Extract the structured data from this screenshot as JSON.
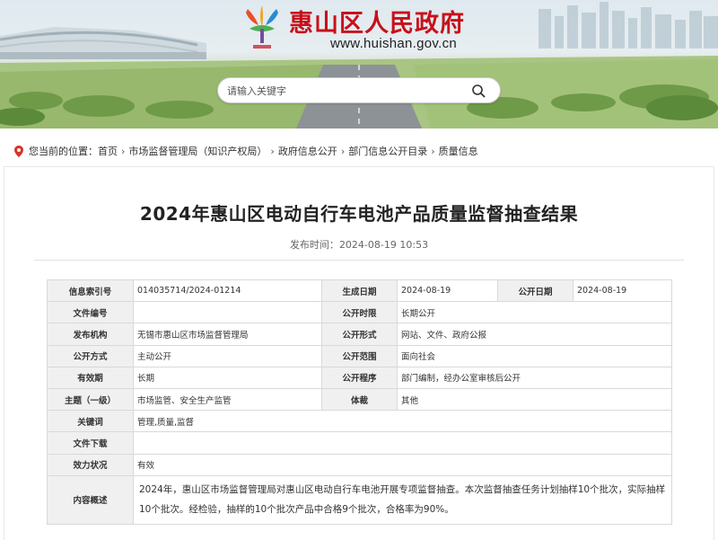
{
  "site": {
    "title": "惠山区人民政府",
    "url": "www.huishan.gov.cn"
  },
  "search": {
    "placeholder": "请输入关键字"
  },
  "breadcrumb": {
    "prefix": "您当前的位置：",
    "items": [
      "首页",
      "市场监督管理局（知识产权局）",
      "政府信息公开",
      "部门信息公开目录",
      "质量信息"
    ],
    "separator": "›"
  },
  "article": {
    "title": "2024年惠山区电动自行车电池产品质量监督抽查结果",
    "publish_label": "发布时间：",
    "publish_time": "2024-08-19 10:53"
  },
  "info_table": {
    "index_label": "信息索引号",
    "index_value": "014035714/2024-01214",
    "created_label": "生成日期",
    "created_value": "2024-08-19",
    "public_date_label": "公开日期",
    "public_date_value": "2024-08-19",
    "doc_no_label": "文件编号",
    "doc_no_value": "",
    "public_period_label": "公开时限",
    "public_period_value": "长期公开",
    "issuer_label": "发布机构",
    "issuer_value": "无锡市惠山区市场监督管理局",
    "public_form_label": "公开形式",
    "public_form_value": "网站、文件、政府公报",
    "public_method_label": "公开方式",
    "public_method_value": "主动公开",
    "public_scope_label": "公开范围",
    "public_scope_value": "面向社会",
    "validity_label": "有效期",
    "validity_value": "长期",
    "procedure_label": "公开程序",
    "procedure_value": "部门编制，经办公室审核后公开",
    "topic_label": "主题（一级）",
    "topic_value": "市场监管、安全生产监管",
    "genre_label": "体裁",
    "genre_value": "其他",
    "keywords_label": "关键词",
    "keywords_value": "管理,质量,监督",
    "download_label": "文件下载",
    "download_value": "",
    "status_label": "效力状况",
    "status_value": "有效",
    "summary_label": "内容概述",
    "summary_value": "2024年，惠山区市场监督管理局对惠山区电动自行车电池开展专项监督抽查。本次监督抽查任务计划抽样10个批次，实际抽样10个批次。经检验，抽样的10个批次产品中合格9个批次，合格率为90%。"
  },
  "colors": {
    "title_red": "#c8101a",
    "label_bg": "#f0f0f0",
    "border": "#d9d9d9"
  },
  "icons": {
    "logo": "huishan-logo-icon",
    "search": "search-icon",
    "location": "location-pin-icon"
  }
}
